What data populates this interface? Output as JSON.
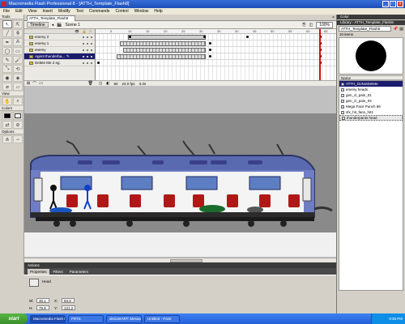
{
  "window": {
    "title": "Macromedia Flash Professional 8 - [ATTH_Template_Flash8]"
  },
  "menu": [
    "File",
    "Edit",
    "View",
    "Insert",
    "Modify",
    "Text",
    "Commands",
    "Control",
    "Window",
    "Help"
  ],
  "tools": {
    "header": "Tools",
    "view_label": "View",
    "colors_label": "Colors",
    "options_label": "Options",
    "icons": [
      "arrow-icon",
      "subselect-icon",
      "line-icon",
      "lasso-icon",
      "pen-icon",
      "text-icon",
      "oval-icon",
      "rect-icon",
      "pencil-icon",
      "brush-icon",
      "free-transform-icon",
      "fill-transform-icon",
      "ink-bottle-icon",
      "paint-bucket-icon",
      "eyedropper-icon",
      "eraser-icon"
    ],
    "glyphs": [
      "↖",
      "⇱",
      "╱",
      "ϕ",
      "✒",
      "A",
      "◯",
      "▭",
      "✎",
      "🖌",
      "⤡",
      "⟲",
      "◉",
      "◈",
      "⌀",
      "▱"
    ]
  },
  "document": {
    "tab": "ATTH_Template_Flash8",
    "scene": "Scene 1",
    "timeline_button": "Timeline",
    "zoom": "100%"
  },
  "timeline": {
    "layers": [
      {
        "name": "enemy 2",
        "active": false
      },
      {
        "name": "enemy 1",
        "active": false
      },
      {
        "name": "enemy",
        "active": false
      },
      {
        "name": "Agent thunderba...",
        "active": true
      },
      {
        "name": "Delete Me 2 eg.",
        "active": false
      }
    ],
    "ruler": [
      "5",
      "10",
      "15",
      "20",
      "25",
      "30",
      "35",
      "40",
      "45",
      "50",
      "55",
      "60",
      "65"
    ],
    "status": {
      "frame": "80",
      "fps": "24.0 fps",
      "time": "3.3s"
    }
  },
  "library": {
    "color_header": "Color",
    "header": "Library - ATTH_Template_Flash8",
    "doc_select": "ATTH_Template_Flash8",
    "count": "10 items",
    "name_col": "Name",
    "items": [
      {
        "name": "ATTH_DoNotDelete",
        "state": "hl"
      },
      {
        "name": "enemy heads",
        "state": ""
      },
      {
        "name": "gen_cl_pain_01",
        "state": ""
      },
      {
        "name": "gen_cl_pain_04",
        "state": ""
      },
      {
        "name": "Mega Face Punch 66",
        "state": ""
      },
      {
        "name": "sfx_hit_face_hit1",
        "state": ""
      },
      {
        "name": "thunderpants head",
        "state": "sel"
      }
    ]
  },
  "bottom": {
    "actions": "Actions",
    "tabs": [
      "Properties",
      "Filters",
      "Parameters"
    ],
    "symbol_type": "Head",
    "w_label": "W:",
    "w": "30.1",
    "h_label": "H:",
    "h": "79.8",
    "x_label": "X:",
    "x": "93.9",
    "y_label": "Y:",
    "y": "121.2"
  },
  "taskbar": {
    "start": "start",
    "tasks": [
      {
        "label": "Macromedia Flash P...",
        "active": true
      },
      {
        "label": "FRTS",
        "active": false
      },
      {
        "label": "deviantART: Messag...",
        "active": false
      },
      {
        "label": "Untitled - Paint",
        "active": false
      }
    ],
    "clock": "9:38 PM"
  }
}
